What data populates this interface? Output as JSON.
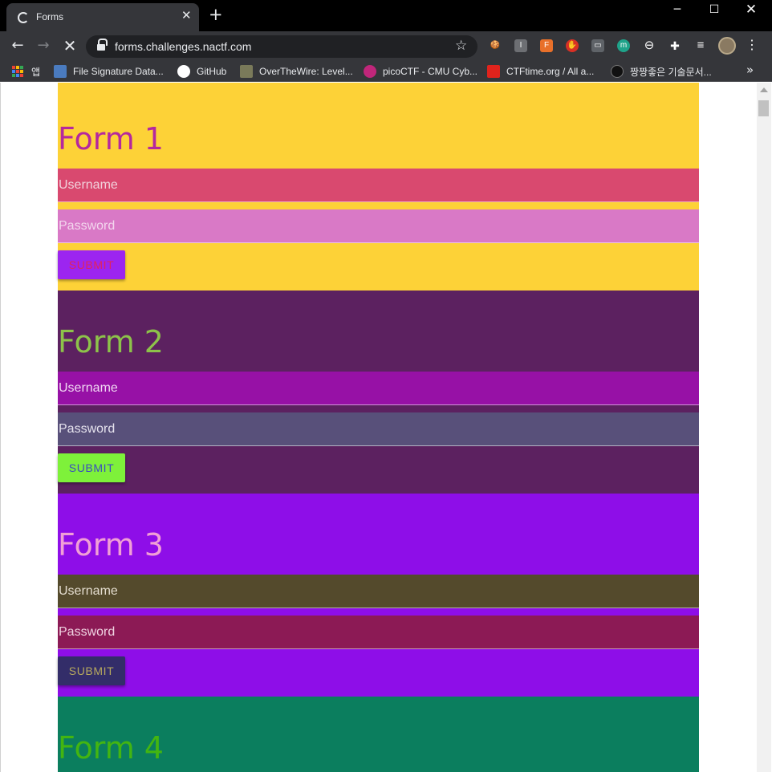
{
  "browser": {
    "tab_title": "Forms",
    "url": "forms.challenges.nactf.com",
    "window_controls": {
      "minimize": "─",
      "maximize": "☐",
      "close": "✕"
    },
    "extensions": [
      {
        "icon": "cookie-icon",
        "label": "🍪",
        "color": "#c58a3b"
      },
      {
        "icon": "info-icon",
        "label": "I",
        "color": "#6d6f73"
      },
      {
        "icon": "foxyproxy-icon",
        "label": "F",
        "color": "#e8702a"
      },
      {
        "icon": "stop-hand-icon",
        "label": "✋",
        "color": "#d93025"
      },
      {
        "icon": "window-icon",
        "label": "▭",
        "color": "#5f6368"
      },
      {
        "icon": "m-icon",
        "label": "m",
        "color": "#1fa38a"
      },
      {
        "icon": "circle-minus-icon",
        "label": "⊖",
        "color": "#35363a"
      },
      {
        "icon": "puzzle-icon",
        "label": "✚",
        "color": "#35363a"
      },
      {
        "icon": "media-icon",
        "label": "≡",
        "color": "#35363a"
      }
    ],
    "bookmarks": [
      {
        "label": "앱",
        "icon": "apps-grid-icon"
      },
      {
        "label": "File Signature Data...",
        "icon": "doc-icon",
        "color": "#4a7bbf"
      },
      {
        "label": "GitHub",
        "icon": "github-icon",
        "color": "#ffffff"
      },
      {
        "label": "OverTheWire: Level...",
        "icon": "otw-icon",
        "color": "#7a7a5a"
      },
      {
        "label": "picoCTF - CMU Cyb...",
        "icon": "picoctf-icon",
        "color": "#c0267a"
      },
      {
        "label": "CTFtime.org / All a...",
        "icon": "ctftime-icon",
        "color": "#e0231c"
      },
      {
        "label": "짱짱좋은 기술문서...",
        "icon": "r-icon",
        "color": "#111111"
      }
    ],
    "bookmarks_more": "»"
  },
  "forms": [
    {
      "heading": "Form 1",
      "username_placeholder": "Username",
      "password_placeholder": "Password",
      "submit_label": "SUBMIT",
      "colors": {
        "bg": "#fdd237",
        "heading": "#b5289e",
        "username_bg": "#d9496f",
        "username_text": "#f1d2dc",
        "password_bg": "#d979c6",
        "password_text": "#f3d6ee",
        "button_bg": "#9c25f0",
        "button_text": "#e0245e"
      }
    },
    {
      "heading": "Form 2",
      "username_placeholder": "Username",
      "password_placeholder": "Password",
      "submit_label": "SUBMIT",
      "colors": {
        "bg": "#5c2160",
        "heading": "#8dc24a",
        "username_bg": "#9711a6",
        "username_text": "#f0d8f2",
        "password_bg": "#58507a",
        "password_text": "#e6e3ee",
        "button_bg": "#7ef13a",
        "button_text": "#3b4cc0"
      }
    },
    {
      "heading": "Form 3",
      "username_placeholder": "Username",
      "password_placeholder": "Password",
      "submit_label": "SUBMIT",
      "colors": {
        "bg": "#8e0ee8",
        "heading": "#f19fd6",
        "username_bg": "#544a2c",
        "username_text": "#e4ddcf",
        "password_bg": "#8c1a55",
        "password_text": "#f0d4e2",
        "button_bg": "#332d69",
        "button_text": "#b7a95e"
      }
    },
    {
      "heading": "Form 4",
      "colors": {
        "bg": "#0b7e5e",
        "heading": "#43b511"
      }
    }
  ]
}
